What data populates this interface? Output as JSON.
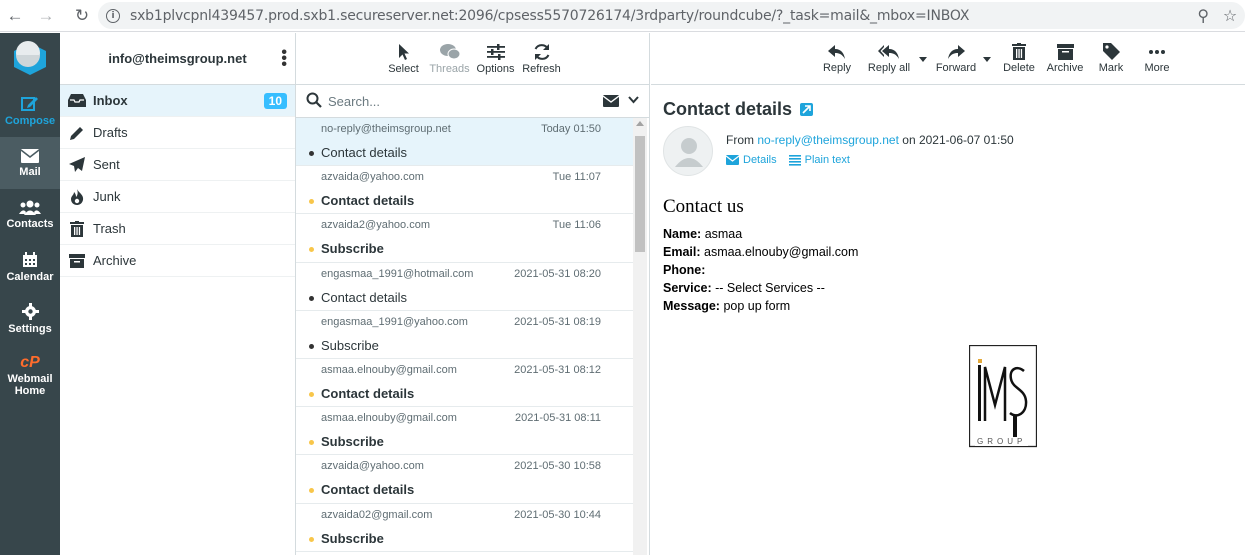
{
  "browser": {
    "url": "sxb1plvcpnl439457.prod.sxb1.secureserver.net:2096/cpsess5570726174/3rdparty/roundcube/?_task=mail&_mbox=INBOX"
  },
  "taskmenu": {
    "compose": "Compose",
    "mail": "Mail",
    "contacts": "Contacts",
    "calendar": "Calendar",
    "settings": "Settings",
    "webmail_home_1": "Webmail",
    "webmail_home_2": "Home"
  },
  "account": "info@theimsgroup.net",
  "folders": [
    {
      "label": "Inbox",
      "count": "10",
      "icon": "inbox-icon"
    },
    {
      "label": "Drafts",
      "icon": "pencil-icon"
    },
    {
      "label": "Sent",
      "icon": "paper-plane-icon"
    },
    {
      "label": "Junk",
      "icon": "fire-icon"
    },
    {
      "label": "Trash",
      "icon": "trash-icon"
    },
    {
      "label": "Archive",
      "icon": "archive-icon"
    }
  ],
  "list_toolbar": {
    "select": "Select",
    "threads": "Threads",
    "options": "Options",
    "refresh": "Refresh"
  },
  "search": {
    "placeholder": "Search..."
  },
  "messages": [
    {
      "from": "no-reply@theimsgroup.net",
      "date": "Today 01:50",
      "subject": "Contact details",
      "unread": false,
      "selected": true
    },
    {
      "from": "azvaida@yahoo.com",
      "date": "Tue 11:07",
      "subject": "Contact details",
      "unread": true
    },
    {
      "from": "azvaida2@yahoo.com",
      "date": "Tue 11:06",
      "subject": "Subscribe",
      "unread": true
    },
    {
      "from": "engasmaa_1991@hotmail.com",
      "date": "2021-05-31 08:20",
      "subject": "Contact details",
      "unread": false
    },
    {
      "from": "engasmaa_1991@yahoo.com",
      "date": "2021-05-31 08:19",
      "subject": "Subscribe",
      "unread": false
    },
    {
      "from": "asmaa.elnouby@gmail.com",
      "date": "2021-05-31 08:12",
      "subject": "Contact details",
      "unread": true
    },
    {
      "from": "asmaa.elnouby@gmail.com",
      "date": "2021-05-31 08:11",
      "subject": "Subscribe",
      "unread": true
    },
    {
      "from": "azvaida@yahoo.com",
      "date": "2021-05-30 10:58",
      "subject": "Contact details",
      "unread": true
    },
    {
      "from": "azvaida02@gmail.com",
      "date": "2021-05-30 10:44",
      "subject": "Subscribe",
      "unread": true
    }
  ],
  "content_toolbar": {
    "reply": "Reply",
    "reply_all": "Reply all",
    "forward": "Forward",
    "delete": "Delete",
    "archive": "Archive",
    "mark": "Mark",
    "more": "More"
  },
  "message": {
    "subject": "Contact details",
    "from_prefix": "From",
    "from_address": "no-reply@theimsgroup.net",
    "on_text": "on 2021-06-07 01:50",
    "details_link": "Details",
    "plaintext_link": "Plain text",
    "body_heading": "Contact us",
    "fields": [
      {
        "label": "Name:",
        "value": " asmaa"
      },
      {
        "label": "Email:",
        "value": " asmaa.elnouby@gmail.com"
      },
      {
        "label": "Phone:",
        "value": ""
      },
      {
        "label": "Service:",
        "value": " -- Select Services --"
      },
      {
        "label": "Message:",
        "value": " pop up form"
      }
    ],
    "logo_text": "GROUP"
  },
  "colors": {
    "accent": "#1ea4db",
    "sidebar_bg": "#37464b",
    "unread_dot": "#f8c64a",
    "badge": "#37beff"
  }
}
